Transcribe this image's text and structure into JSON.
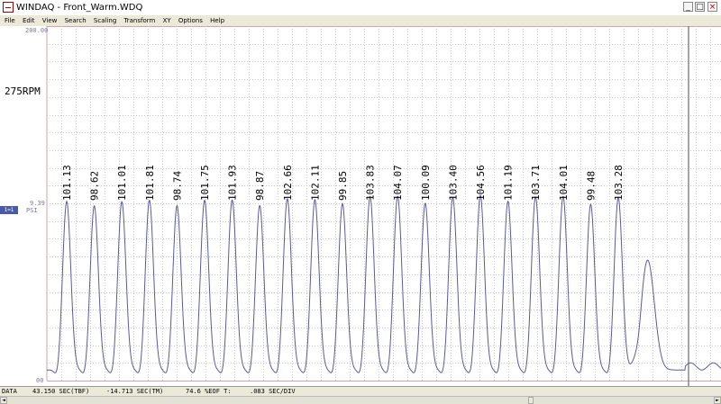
{
  "window": {
    "title": "WINDAQ - Front_Warm.WDQ",
    "icon": "windaq-app-icon",
    "controls": [
      "_",
      "□",
      "×"
    ]
  },
  "menu": [
    "File",
    "Edit",
    "View",
    "Search",
    "Scaling",
    "Transform",
    "XY",
    "Options",
    "Help"
  ],
  "plot": {
    "y_top_label": "200.00",
    "y_mid_label": "9.39",
    "y_bottom_label": "00",
    "rpm_label": "275RPM",
    "channel_badge": "1=1",
    "unit_label": "PSI",
    "colors": {
      "grid": "#c9c9d6",
      "grid_major": "#d9a2a2",
      "trace": "#5a5a9e",
      "cursor": "#6a6a6a",
      "text": "#2a2a7a"
    }
  },
  "chart_data": {
    "type": "line",
    "peak_labels": [
      "101.13",
      "98.62",
      "101.01",
      "101.81",
      "98.74",
      "101.75",
      "101.93",
      "98.87",
      "102.66",
      "102.11",
      "99.85",
      "103.83",
      "104.07",
      "100.09",
      "103.40",
      "104.56",
      "101.19",
      "103.71",
      "104.01",
      "99.48",
      "103.28"
    ],
    "peak_values": [
      101.13,
      98.62,
      101.01,
      101.81,
      98.74,
      101.75,
      101.93,
      98.87,
      102.66,
      102.11,
      99.85,
      103.83,
      104.07,
      100.09,
      103.4,
      104.56,
      101.19,
      103.71,
      104.01,
      99.48,
      103.28
    ],
    "final_partial_peak": 68,
    "ylim": [
      0,
      200
    ],
    "ylabel": "PSI"
  },
  "status": {
    "data_label": "DATA",
    "tbf": "43.150 SEC(TBF)",
    "tm": "-14.713 SEC(TM)",
    "eof": "74.6 %EOF T:",
    "div": ".083 SEC/DIV"
  },
  "scrollbar": {
    "left_arrow": "◄",
    "right_arrow": "►"
  }
}
